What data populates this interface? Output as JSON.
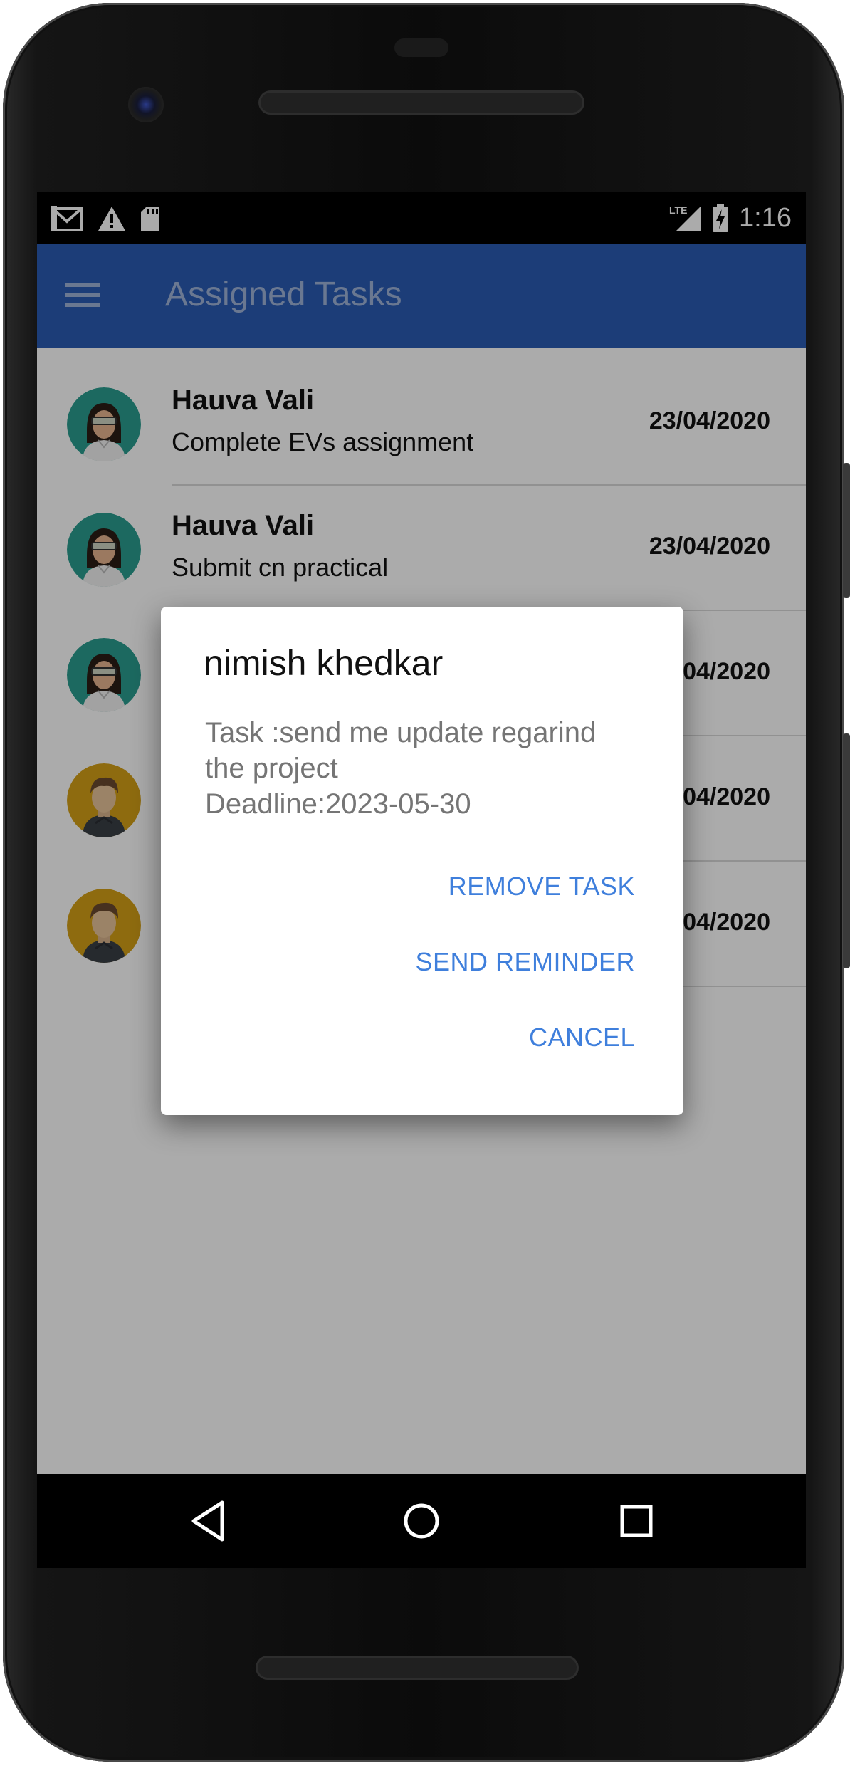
{
  "status_bar": {
    "time": "1:16",
    "left_icons": [
      "gmail-icon",
      "warning-icon",
      "sd-card-icon"
    ],
    "right_icons": [
      "lte-signal-icon",
      "battery-charging-icon"
    ],
    "network_label": "LTE"
  },
  "app_bar": {
    "title": "Assigned Tasks",
    "menu_icon": "hamburger-menu-icon",
    "color": "#2a5bb3"
  },
  "tasks": [
    {
      "name": "Hauva Vali",
      "description": "Complete EVs assignment",
      "date": "23/04/2020",
      "avatar": "female-avatar"
    },
    {
      "name": "Hauva Vali",
      "description": "Submit cn practical",
      "date": "23/04/2020",
      "avatar": "female-avatar"
    },
    {
      "name": "",
      "description": "",
      "date": "04/2020",
      "avatar": "female-avatar"
    },
    {
      "name": "",
      "description": "",
      "date": "04/2020",
      "avatar": "male-avatar"
    },
    {
      "name": "",
      "description": "",
      "date": "04/2020",
      "avatar": "male-avatar"
    }
  ],
  "dialog": {
    "title": "nimish khedkar",
    "message_line1": "Task :send me update regarind",
    "message_line2": "the project",
    "message_line3": "Deadline:2023-05-30",
    "remove_label": "REMOVE TASK",
    "reminder_label": "SEND REMINDER",
    "cancel_label": "CANCEL",
    "accent": "#3f7fdc"
  },
  "fab": {
    "icon": "add-icon",
    "color": "#2a5bb3"
  },
  "nav_bar": {
    "back": "back-icon",
    "home": "home-icon",
    "recents": "recents-icon"
  }
}
